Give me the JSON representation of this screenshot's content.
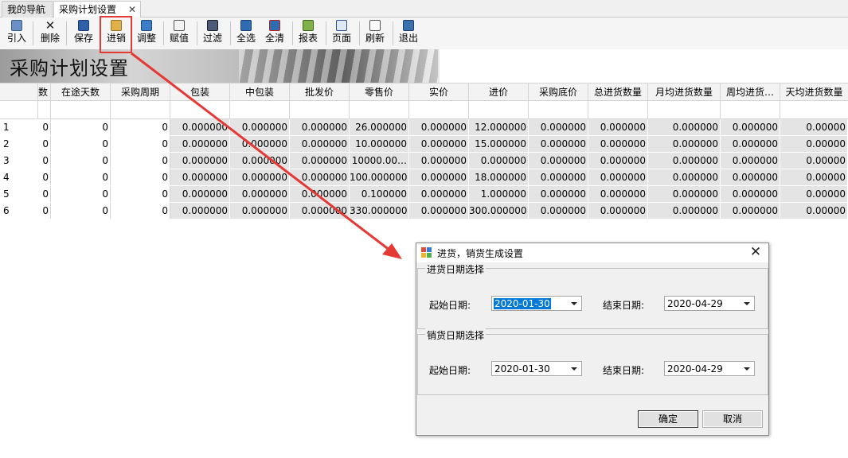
{
  "tabs": [
    {
      "label": "我的导航"
    },
    {
      "label": "采购计划设置",
      "close": "✕"
    }
  ],
  "toolbar": [
    {
      "label": "引入",
      "icon": "import-icon"
    },
    {
      "label": "删除",
      "icon": "delete-icon"
    },
    {
      "label": "保存",
      "icon": "save-icon"
    },
    {
      "label": "进销",
      "icon": "purchase-sales-icon"
    },
    {
      "label": "调整",
      "icon": "adjust-icon"
    },
    {
      "label": "赋值",
      "icon": "assign-icon"
    },
    {
      "label": "过滤",
      "icon": "filter-icon"
    },
    {
      "label": "全选",
      "icon": "select-all-icon"
    },
    {
      "label": "全清",
      "icon": "clear-all-icon"
    },
    {
      "label": "报表",
      "icon": "report-icon"
    },
    {
      "label": "页面",
      "icon": "page-icon"
    },
    {
      "label": "刷新",
      "icon": "refresh-icon"
    },
    {
      "label": "退出",
      "icon": "exit-icon"
    }
  ],
  "banner": {
    "title": "采购计划设置"
  },
  "grid": {
    "headers": [
      "",
      "数",
      "在途天数",
      "采购周期",
      "包装",
      "中包装",
      "批发价",
      "零售价",
      "实价",
      "进价",
      "采购底价",
      "总进货数量",
      "月均进货数量",
      "周均进货…",
      "天均进货数量"
    ],
    "rows": [
      [
        "1",
        "0",
        "0",
        "0",
        "0.000000",
        "0.000000",
        "0.000000",
        "26.000000",
        "0.000000",
        "12.000000",
        "0.000000",
        "0.000000",
        "0.000000",
        "0.000000",
        "0.00000"
      ],
      [
        "2",
        "0",
        "0",
        "0",
        "0.000000",
        "0.000000",
        "0.000000",
        "10.000000",
        "0.000000",
        "15.000000",
        "0.000000",
        "0.000000",
        "0.000000",
        "0.000000",
        "0.00000"
      ],
      [
        "3",
        "0",
        "0",
        "0",
        "0.000000",
        "0.000000",
        "0.000000",
        "10000.00…",
        "0.000000",
        "0.000000",
        "0.000000",
        "0.000000",
        "0.000000",
        "0.000000",
        "0.00000"
      ],
      [
        "4",
        "0",
        "0",
        "0",
        "0.000000",
        "0.000000",
        "0.000000",
        "100.000000",
        "0.000000",
        "18.000000",
        "0.000000",
        "0.000000",
        "0.000000",
        "0.000000",
        "0.00000"
      ],
      [
        "5",
        "0",
        "0",
        "0",
        "0.000000",
        "0.000000",
        "0.000000",
        "0.100000",
        "0.000000",
        "1.000000",
        "0.000000",
        "0.000000",
        "0.000000",
        "0.000000",
        "0.00000"
      ],
      [
        "6",
        "0",
        "0",
        "0",
        "0.000000",
        "0.000000",
        "0.000000",
        "330.000000",
        "0.000000",
        "300.000000",
        "0.000000",
        "0.000000",
        "0.000000",
        "0.000000",
        "0.00000"
      ]
    ]
  },
  "dialog": {
    "title": "进货，销货生成设置",
    "close": "✕",
    "purchase_group": {
      "legend": "进货日期选择",
      "start_label": "起始日期:",
      "start_value": "2020-01-30",
      "end_label": "结束日期:",
      "end_value": "2020-04-29"
    },
    "sales_group": {
      "legend": "销货日期选择",
      "start_label": "起始日期:",
      "start_value": "2020-01-30",
      "end_label": "结束日期:",
      "end_value": "2020-04-29"
    },
    "ok_label": "确定",
    "cancel_label": "取消"
  },
  "colors": {
    "highlight": "#e53935",
    "arrow": "#e53935",
    "selection": "#0078d7"
  }
}
